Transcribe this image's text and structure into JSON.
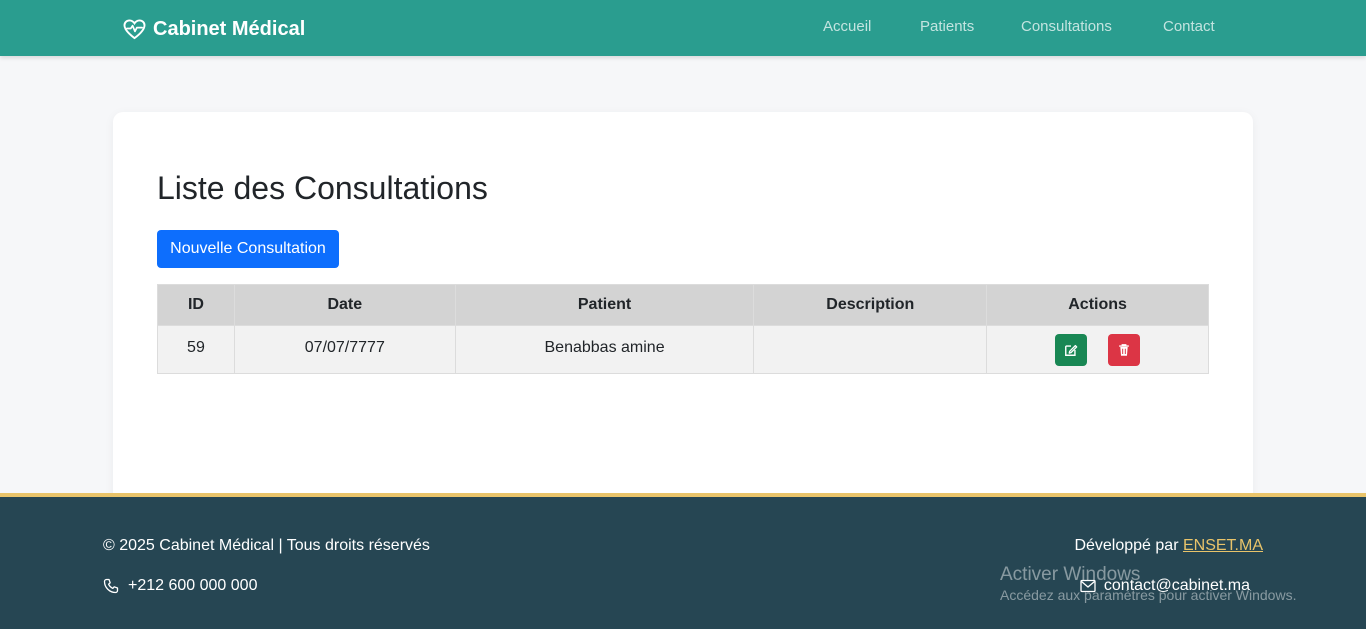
{
  "navbar": {
    "brand": "Cabinet Médical",
    "links": [
      "Accueil",
      "Patients",
      "Consultations",
      "Contact"
    ]
  },
  "main": {
    "title": "Liste des Consultations",
    "new_button": "Nouvelle Consultation",
    "table": {
      "headers": [
        "ID",
        "Date",
        "Patient",
        "Description",
        "Actions"
      ],
      "rows": [
        {
          "id": "59",
          "date": "07/07/7777",
          "patient": "Benabbas amine",
          "description": ""
        }
      ]
    }
  },
  "footer": {
    "copyright": "© 2025 Cabinet Médical | Tous droits réservés",
    "phone": "+212 600 000 000",
    "developed_by": "Développé par",
    "developer_link": "ENSET.MA",
    "email": "contact@cabinet.ma"
  },
  "watermark": {
    "title": "Activer Windows",
    "subtitle": "Accédez aux paramètres pour activer Windows."
  },
  "colors": {
    "navbar": "#2a9d8f",
    "primary": "#0d6efd",
    "success": "#198754",
    "danger": "#dc3545",
    "footer": "#264653",
    "accent": "#e9c46a"
  },
  "icons": {
    "brand": "heart-pulse-icon",
    "edit": "pencil-square-icon",
    "delete": "trash-icon",
    "phone": "phone-icon",
    "email": "envelope-icon"
  }
}
